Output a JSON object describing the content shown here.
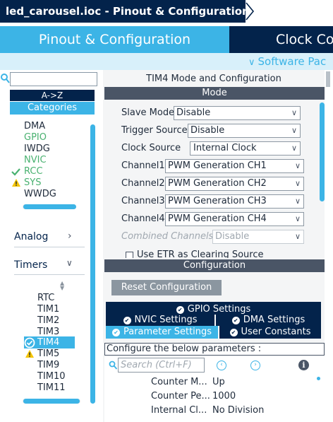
{
  "window": {
    "title": "led_carousel.ioc - Pinout & Configuration"
  },
  "tabs": {
    "pinout": "Pinout & Configuration",
    "clock": "Clock Co",
    "software_packs": "Software Pac"
  },
  "left_panel": {
    "search_value": "",
    "az_label": "A->Z",
    "categories_label": "Categories",
    "system_core_items": [
      {
        "label": "DMA",
        "status": "none"
      },
      {
        "label": "GPIO",
        "status": "green"
      },
      {
        "label": "IWDG",
        "status": "none"
      },
      {
        "label": "NVIC",
        "status": "green"
      },
      {
        "label": "RCC",
        "status": "check"
      },
      {
        "label": "SYS",
        "status": "warning"
      },
      {
        "label": "WWDG",
        "status": "none"
      }
    ],
    "analog_label": "Analog",
    "timers_label": "Timers",
    "timer_items": [
      {
        "label": "RTC",
        "status": "none"
      },
      {
        "label": "TIM1",
        "status": "none"
      },
      {
        "label": "TIM2",
        "status": "none"
      },
      {
        "label": "TIM3",
        "status": "none"
      },
      {
        "label": "TIM4",
        "status": "check-selected"
      },
      {
        "label": "TIM5",
        "status": "warning"
      },
      {
        "label": "TIM9",
        "status": "none"
      },
      {
        "label": "TIM10",
        "status": "none"
      },
      {
        "label": "TIM11",
        "status": "none"
      }
    ]
  },
  "mode_panel": {
    "title": "TIM4 Mode and Configuration",
    "section": "Mode",
    "fields": {
      "slave_mode": {
        "label": "Slave Mode",
        "value": "Disable"
      },
      "trigger_source": {
        "label": "Trigger Source",
        "value": "Disable"
      },
      "clock_source": {
        "label": "Clock Source",
        "value": "Internal Clock"
      },
      "channel1": {
        "label": "Channel1",
        "value": "PWM Generation CH1"
      },
      "channel2": {
        "label": "Channel2",
        "value": "PWM Generation CH2"
      },
      "channel3": {
        "label": "Channel3",
        "value": "PWM Generation CH3"
      },
      "channel4": {
        "label": "Channel4",
        "value": "PWM Generation CH4"
      },
      "combined_channels": {
        "label": "Combined Channels",
        "value": "Disable"
      }
    },
    "etr_checkbox_label": "Use ETR as Clearing Source"
  },
  "config_panel": {
    "section": "Configuration",
    "reset_label": "Reset Configuration",
    "tabs": {
      "gpio": "GPIO Settings",
      "nvic": "NVIC Settings",
      "dma": "DMA Settings",
      "params": "Parameter Settings",
      "user_constants": "User Constants"
    },
    "params_header": "Configure the below parameters :",
    "search_placeholder": "Search (Ctrl+F)",
    "params": [
      {
        "name": "Counter M...",
        "value": "Up"
      },
      {
        "name": "Counter Pe...",
        "value": "1000"
      },
      {
        "name": "Internal Cl...",
        "value": "No Division"
      }
    ]
  },
  "colors": {
    "navy": "#03234b",
    "accent": "#3cb4e6",
    "band_gray": "#4a5566",
    "ok_green": "#49b170",
    "warn_yellow": "#f5c400"
  }
}
